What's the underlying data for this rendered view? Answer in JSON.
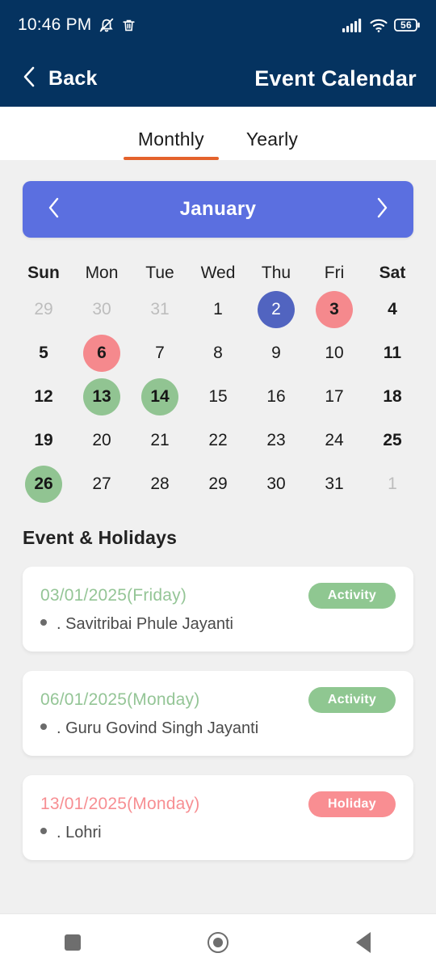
{
  "status_bar": {
    "time": "10:46 PM",
    "icons": [
      "bell-muted-icon",
      "trash-icon",
      "signal-icon",
      "wifi-icon",
      "battery-icon"
    ],
    "battery_level": "56"
  },
  "app_bar": {
    "back_label": "Back",
    "title": "Event Calendar"
  },
  "tabs": [
    {
      "label": "Monthly",
      "active": true
    },
    {
      "label": "Yearly",
      "active": false
    }
  ],
  "month_nav": {
    "prev_icon": "chevron-left-icon",
    "next_icon": "chevron-right-icon",
    "month": "January"
  },
  "calendar": {
    "weekday_headers": [
      "Sun",
      "Mon",
      "Tue",
      "Wed",
      "Thu",
      "Fri",
      "Sat"
    ],
    "weeks": [
      [
        {
          "day": "29",
          "style": "muted"
        },
        {
          "day": "30",
          "style": "muted"
        },
        {
          "day": "31",
          "style": "muted"
        },
        {
          "day": "1",
          "style": "normal"
        },
        {
          "day": "2",
          "style": "blue"
        },
        {
          "day": "3",
          "style": "red"
        },
        {
          "day": "4",
          "style": "normal"
        }
      ],
      [
        {
          "day": "5",
          "style": "normal"
        },
        {
          "day": "6",
          "style": "red"
        },
        {
          "day": "7",
          "style": "normal"
        },
        {
          "day": "8",
          "style": "normal"
        },
        {
          "day": "9",
          "style": "normal"
        },
        {
          "day": "10",
          "style": "normal"
        },
        {
          "day": "11",
          "style": "normal"
        }
      ],
      [
        {
          "day": "12",
          "style": "normal"
        },
        {
          "day": "13",
          "style": "green"
        },
        {
          "day": "14",
          "style": "green"
        },
        {
          "day": "15",
          "style": "normal"
        },
        {
          "day": "16",
          "style": "normal"
        },
        {
          "day": "17",
          "style": "normal"
        },
        {
          "day": "18",
          "style": "normal"
        }
      ],
      [
        {
          "day": "19",
          "style": "normal"
        },
        {
          "day": "20",
          "style": "normal"
        },
        {
          "day": "21",
          "style": "normal"
        },
        {
          "day": "22",
          "style": "normal"
        },
        {
          "day": "23",
          "style": "normal"
        },
        {
          "day": "24",
          "style": "normal"
        },
        {
          "day": "25",
          "style": "normal"
        }
      ],
      [
        {
          "day": "26",
          "style": "green"
        },
        {
          "day": "27",
          "style": "normal"
        },
        {
          "day": "28",
          "style": "normal"
        },
        {
          "day": "29",
          "style": "normal"
        },
        {
          "day": "30",
          "style": "normal"
        },
        {
          "day": "31",
          "style": "normal"
        },
        {
          "day": "1",
          "style": "muted"
        }
      ]
    ]
  },
  "events_section": {
    "title": "Event & Holidays",
    "cards": [
      {
        "date": "03/01/2025(Friday)",
        "badge": "Activity",
        "type": "activity",
        "item": ". Savitribai Phule Jayanti"
      },
      {
        "date": "06/01/2025(Monday)",
        "badge": "Activity",
        "type": "activity",
        "item": ". Guru Govind Singh Jayanti"
      },
      {
        "date": "13/01/2025(Monday)",
        "badge": "Holiday",
        "type": "holiday",
        "item": ". Lohri"
      }
    ]
  },
  "nav_bar": {
    "recents_icon": "square-icon",
    "home_icon": "circle-icon",
    "back_icon": "triangle-left-icon"
  },
  "colors": {
    "header_navy": "#053360",
    "accent_blue": "#5b6fe0",
    "tab_underline_orange": "#e4622c",
    "selected_blue": "#5164c0",
    "holiday_red": "#f5898d",
    "activity_green": "#91c492",
    "page_background": "#f0f0f0"
  }
}
